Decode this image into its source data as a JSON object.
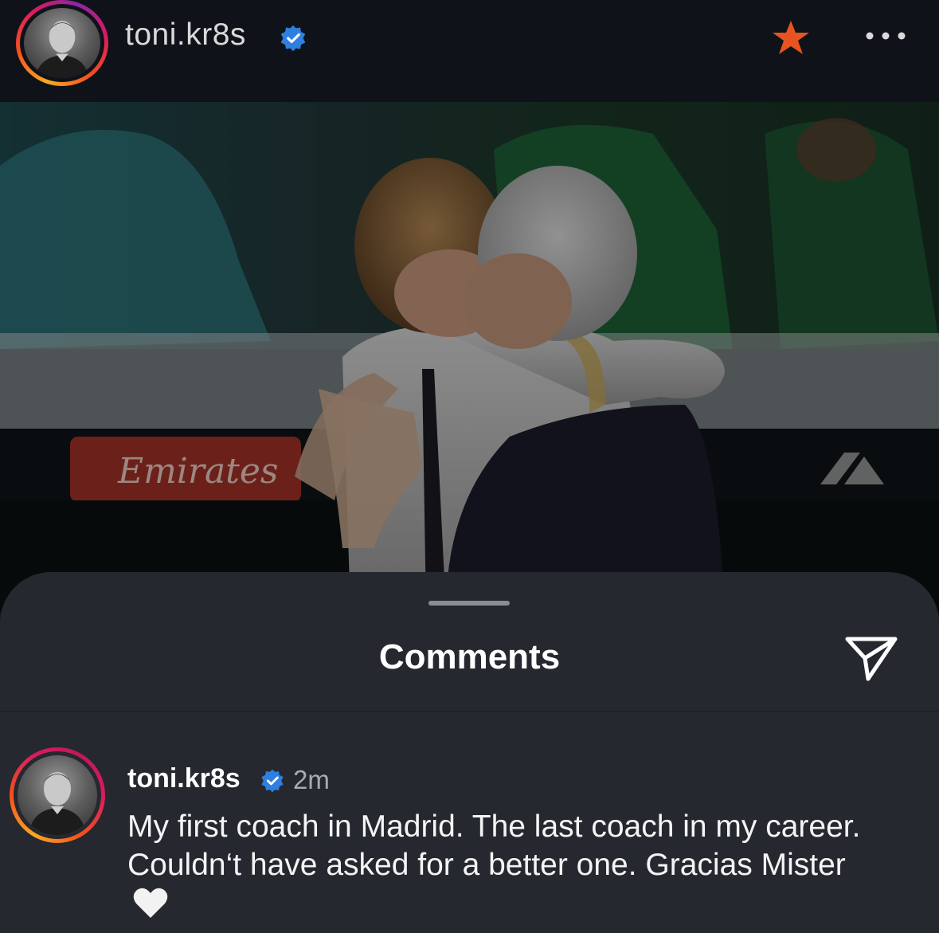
{
  "header": {
    "username": "toni.kr8s",
    "verified_icon": "verified-badge-icon",
    "favorite_icon": "star-icon",
    "more_icon": "more-options-icon",
    "colors": {
      "verified": "#2f7fe0",
      "star": "#e8531f"
    }
  },
  "photo": {
    "description_icon": "post-photo",
    "banner_text": "Emirates"
  },
  "comments_sheet": {
    "title": "Comments",
    "share_icon": "send-icon",
    "comment": {
      "username": "toni.kr8s",
      "time": "2m",
      "text": "My first coach in Madrid. The last coach in my career. Couldn‘t have asked for a better one. Gracias Mister",
      "emoji_icon": "white-heart-icon"
    }
  }
}
